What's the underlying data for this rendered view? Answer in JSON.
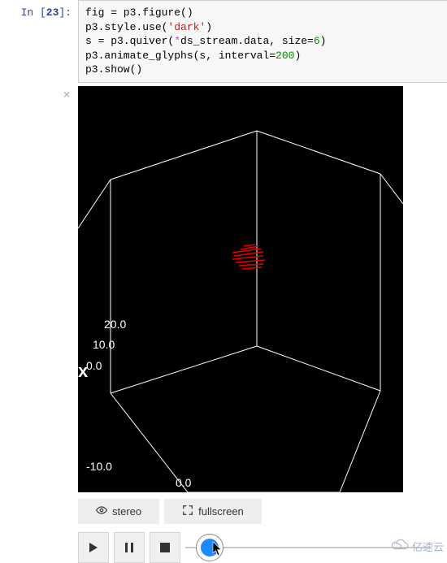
{
  "cell": {
    "prompt_label": "In [",
    "prompt_num": "23",
    "prompt_close": "]:",
    "code": {
      "l1a": "fig = p3.figure()",
      "l2a": "p3.style.use(",
      "l2b": "'dark'",
      "l2c": ")",
      "l3a": "s = p3.quiver(",
      "l3b": "*",
      "l3c": "ds_stream.data, size=",
      "l3d": "6",
      "l3e": ")",
      "l4a": "p3.animate_glyphs(s, interval=",
      "l4b": "200",
      "l4c": ")",
      "l5a": "p3.show()"
    }
  },
  "close_icon": "×",
  "viz": {
    "ticks": {
      "t20": "20.0",
      "t10": "10.0",
      "t0": "0.0",
      "tm10": "-10.0",
      "bz0": "0.0"
    },
    "x_label": "x"
  },
  "buttons": {
    "stereo": "stereo",
    "fullscreen": "fullscreen"
  },
  "watermark": "亿速云"
}
